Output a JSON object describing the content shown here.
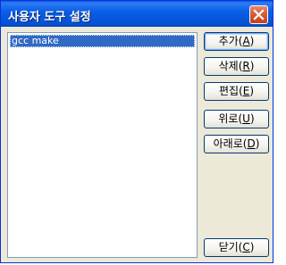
{
  "window": {
    "title": "사용자 도구 설정"
  },
  "titlebar": {
    "close_icon": "close-x-icon"
  },
  "tools_list": {
    "items": [
      {
        "label": "gcc make",
        "selected": true
      }
    ]
  },
  "buttons": {
    "add": {
      "label": "추가",
      "hotkey_open": "(",
      "hotkey": "A",
      "hotkey_close": ")"
    },
    "delete": {
      "label": "삭제",
      "hotkey_open": "(",
      "hotkey": "R",
      "hotkey_close": ")"
    },
    "edit": {
      "label": "편집",
      "hotkey_open": "(",
      "hotkey": "E",
      "hotkey_close": ")"
    },
    "up": {
      "label": "위로",
      "hotkey_open": "(",
      "hotkey": "U",
      "hotkey_close": ")"
    },
    "down": {
      "label": "아래로",
      "hotkey_open": "(",
      "hotkey": "D",
      "hotkey_close": ")"
    },
    "close": {
      "label": "닫기",
      "hotkey_open": "(",
      "hotkey": "C",
      "hotkey_close": ")"
    }
  },
  "colors": {
    "titlebar": "#0a5fe6",
    "selection": "#316ac5",
    "close_button": "#d95b36",
    "dialog_bg": "#ece9d8"
  }
}
